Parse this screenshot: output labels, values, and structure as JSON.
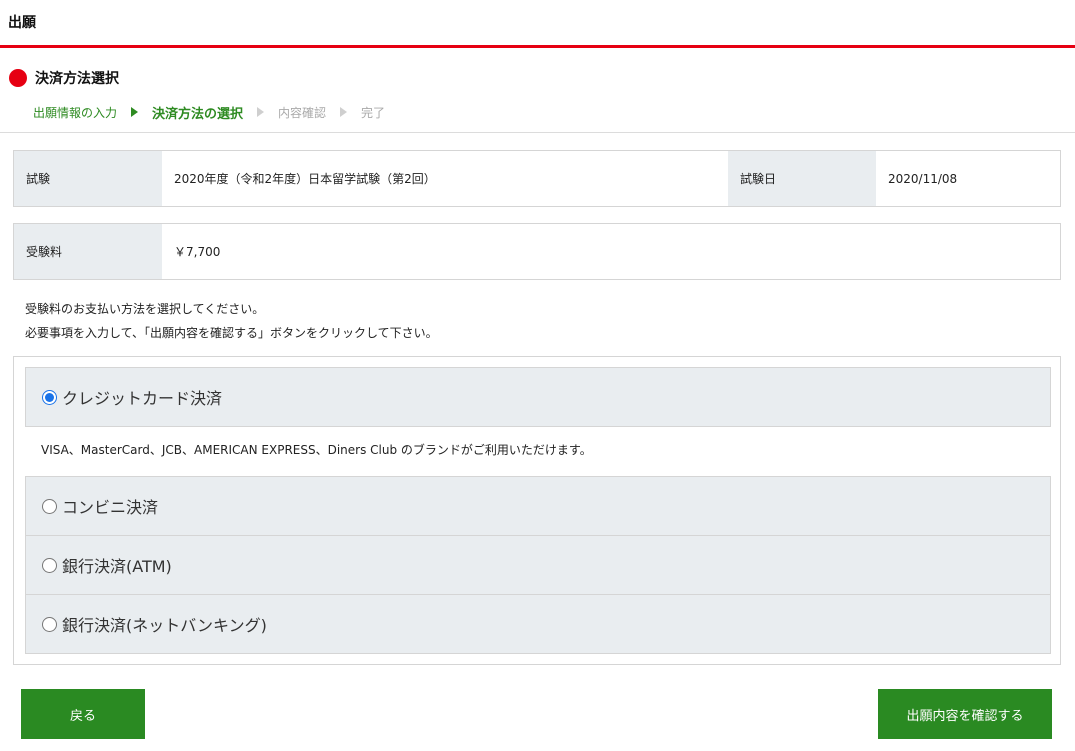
{
  "header": {
    "title": "出願"
  },
  "section": {
    "title": "決済方法選択"
  },
  "steps": [
    {
      "label": "出願情報の入力",
      "state": "done"
    },
    {
      "label": "決済方法の選択",
      "state": "current"
    },
    {
      "label": "内容確認",
      "state": "todo"
    },
    {
      "label": "完了",
      "state": "todo"
    }
  ],
  "exam": {
    "label": "試験",
    "value": "2020年度（令和2年度）日本留学試験（第2回）",
    "date_label": "試験日",
    "date_value": "2020/11/08"
  },
  "fee": {
    "label": "受験料",
    "value": "￥7,700"
  },
  "instructions": {
    "line1": "受験料のお支払い方法を選択してください。",
    "line2": "必要事項を入力して、「出願内容を確認する」ボタンをクリックして下さい。"
  },
  "payment": {
    "credit_label": "クレジットカード決済",
    "credit_brands": "VISA、MasterCard、JCB、AMERICAN EXPRESS、Diners Club のブランドがご利用いただけます。",
    "convenience_label": "コンビニ決済",
    "atm_label": "銀行決済(ATM)",
    "netbank_label": "銀行決済(ネットバンキング)",
    "selected": "credit"
  },
  "buttons": {
    "back": "戻る",
    "confirm": "出願内容を確認する"
  },
  "colors": {
    "accent_red": "#e60012",
    "green": "#2a8a22",
    "radio_blue": "#1a73e8"
  }
}
